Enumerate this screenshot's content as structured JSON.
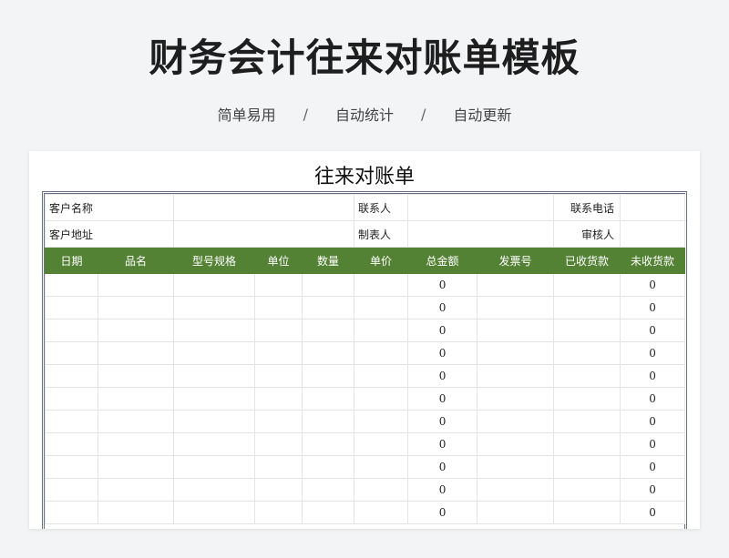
{
  "header": {
    "title": "财务会计往来对账单模板",
    "tags": [
      "简单易用",
      "自动统计",
      "自动更新"
    ],
    "separator": "/"
  },
  "sheet": {
    "title": "往来对账单",
    "info": {
      "customer_name_label": "客户名称",
      "contact_label": "联系人",
      "phone_label": "联系电话",
      "customer_address_label": "客户地址",
      "preparer_label": "制表人",
      "reviewer_label": "审核人"
    },
    "columns": [
      "日期",
      "品名",
      "型号规格",
      "单位",
      "数量",
      "单价",
      "总金额",
      "发票号",
      "已收货款",
      "未收货款"
    ],
    "rows": [
      {
        "total": "0",
        "unpaid": "0"
      },
      {
        "total": "0",
        "unpaid": "0"
      },
      {
        "total": "0",
        "unpaid": "0"
      },
      {
        "total": "0",
        "unpaid": "0"
      },
      {
        "total": "0",
        "unpaid": "0"
      },
      {
        "total": "0",
        "unpaid": "0"
      },
      {
        "total": "0",
        "unpaid": "0"
      },
      {
        "total": "0",
        "unpaid": "0"
      },
      {
        "total": "0",
        "unpaid": "0"
      },
      {
        "total": "0",
        "unpaid": "0"
      },
      {
        "total": "0",
        "unpaid": "0"
      }
    ]
  },
  "colors": {
    "header_green": "#548235",
    "frame_border": "#6b7080"
  }
}
